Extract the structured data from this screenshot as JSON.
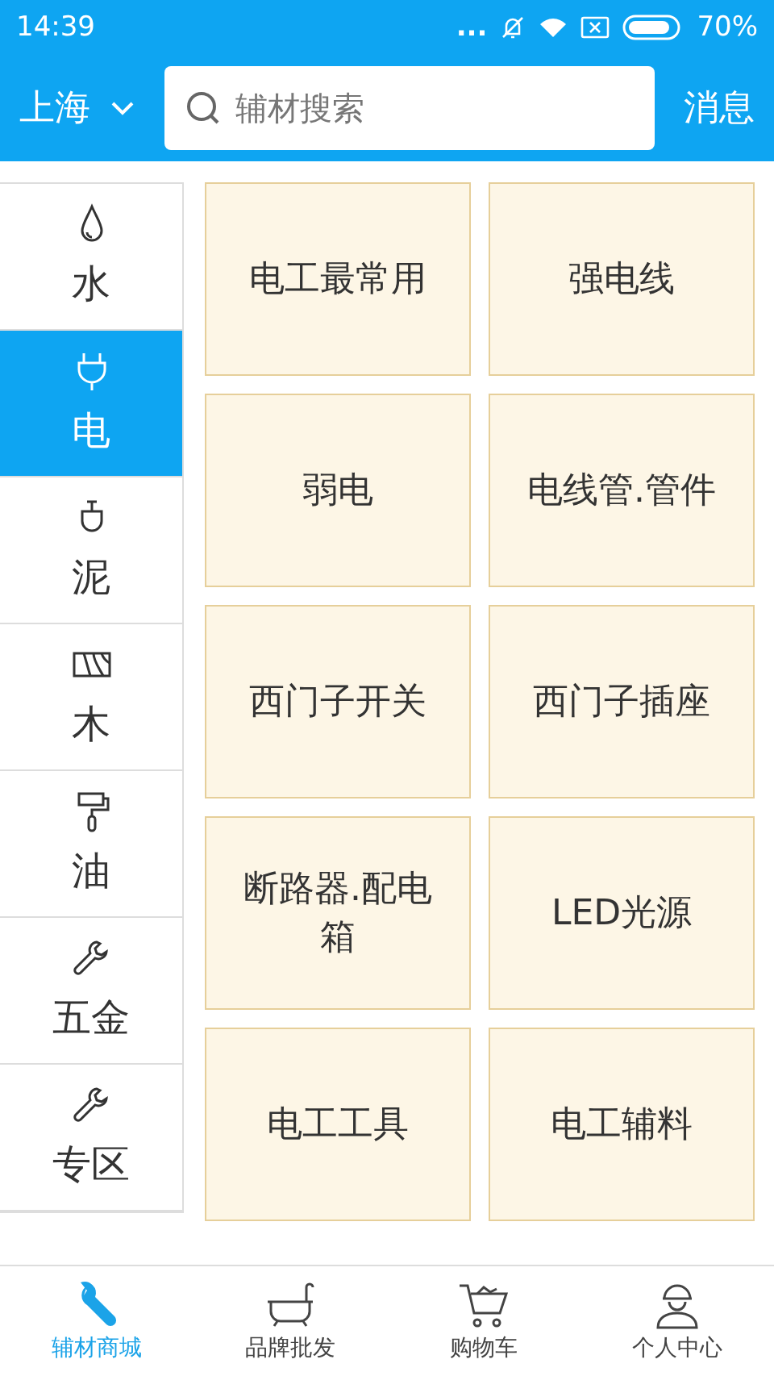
{
  "status_bar": {
    "time": "14:39",
    "dots": "...",
    "battery": "70%"
  },
  "header": {
    "city": "上海",
    "search": {
      "placeholder": "辅材搜索"
    },
    "messages": "消息"
  },
  "categories": [
    {
      "label": "水",
      "selected": false
    },
    {
      "label": "电",
      "selected": true
    },
    {
      "label": "泥",
      "selected": false
    },
    {
      "label": "木",
      "selected": false
    },
    {
      "label": "油",
      "selected": false
    },
    {
      "label": "五金",
      "selected": false
    },
    {
      "label": "专区",
      "selected": false
    }
  ],
  "subcategories": [
    "电工最常用",
    "强电线",
    "弱电",
    "电线管.管件",
    "西门子开关",
    "西门子插座",
    "断路器.配电箱",
    "LED光源",
    "电工工具",
    "电工辅料"
  ],
  "tab_bar": [
    {
      "label": "辅材商城",
      "selected": true
    },
    {
      "label": "品牌批发",
      "selected": false
    },
    {
      "label": "购物车",
      "selected": false
    },
    {
      "label": "个人中心",
      "selected": false
    }
  ]
}
